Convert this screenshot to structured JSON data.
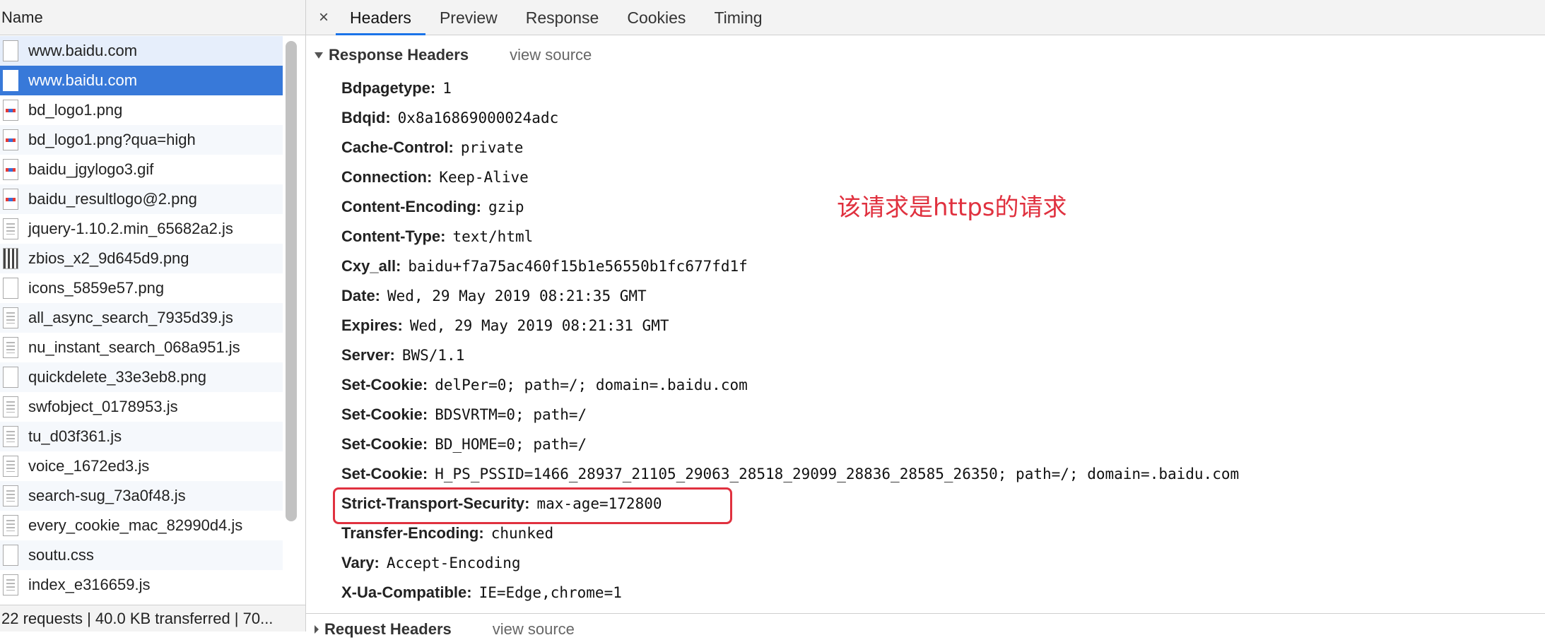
{
  "network_panel": {
    "name_header": "Name",
    "requests": [
      {
        "name": "www.baidu.com",
        "icon": "document-icon",
        "state": "first"
      },
      {
        "name": "www.baidu.com",
        "icon": "document-icon",
        "state": "selected"
      },
      {
        "name": "bd_logo1.png",
        "icon": "image-icon"
      },
      {
        "name": "bd_logo1.png?qua=high",
        "icon": "image-icon"
      },
      {
        "name": "baidu_jgylogo3.gif",
        "icon": "image-icon"
      },
      {
        "name": "baidu_resultlogo@2.png",
        "icon": "image-icon"
      },
      {
        "name": "jquery-1.10.2.min_65682a2.js",
        "icon": "script-icon"
      },
      {
        "name": "zbios_x2_9d645d9.png",
        "icon": "qr-image-icon"
      },
      {
        "name": "icons_5859e57.png",
        "icon": "document-icon"
      },
      {
        "name": "all_async_search_7935d39.js",
        "icon": "script-icon"
      },
      {
        "name": "nu_instant_search_068a951.js",
        "icon": "script-icon"
      },
      {
        "name": "quickdelete_33e3eb8.png",
        "icon": "document-icon"
      },
      {
        "name": "swfobject_0178953.js",
        "icon": "script-icon"
      },
      {
        "name": "tu_d03f361.js",
        "icon": "script-icon"
      },
      {
        "name": "voice_1672ed3.js",
        "icon": "script-icon"
      },
      {
        "name": "search-sug_73a0f48.js",
        "icon": "script-icon"
      },
      {
        "name": "every_cookie_mac_82990d4.js",
        "icon": "script-icon"
      },
      {
        "name": "soutu.css",
        "icon": "document-icon"
      },
      {
        "name": "index_e316659.js",
        "icon": "script-icon"
      }
    ],
    "status": "22 requests | 40.0 KB transferred | 70..."
  },
  "detail_panel": {
    "close_glyph": "×",
    "tabs": [
      "Headers",
      "Preview",
      "Response",
      "Cookies",
      "Timing"
    ],
    "active_tab": "Headers",
    "section_title": "Response Headers",
    "view_source": "view source",
    "headers": [
      {
        "key": "Bdpagetype:",
        "value": "1"
      },
      {
        "key": "Bdqid:",
        "value": "0x8a16869000024adc"
      },
      {
        "key": "Cache-Control:",
        "value": "private"
      },
      {
        "key": "Connection:",
        "value": "Keep-Alive"
      },
      {
        "key": "Content-Encoding:",
        "value": "gzip"
      },
      {
        "key": "Content-Type:",
        "value": "text/html"
      },
      {
        "key": "Cxy_all:",
        "value": "baidu+f7a75ac460f15b1e56550b1fc677fd1f"
      },
      {
        "key": "Date:",
        "value": "Wed, 29 May 2019 08:21:35 GMT"
      },
      {
        "key": "Expires:",
        "value": "Wed, 29 May 2019 08:21:31 GMT"
      },
      {
        "key": "Server:",
        "value": "BWS/1.1"
      },
      {
        "key": "Set-Cookie:",
        "value": "delPer=0; path=/; domain=.baidu.com"
      },
      {
        "key": "Set-Cookie:",
        "value": "BDSVRTM=0; path=/"
      },
      {
        "key": "Set-Cookie:",
        "value": "BD_HOME=0; path=/"
      },
      {
        "key": "Set-Cookie:",
        "value": "H_PS_PSSID=1466_28937_21105_29063_28518_29099_28836_28585_26350; path=/; domain=.baidu.com"
      },
      {
        "key": "Strict-Transport-Security:",
        "value": "max-age=172800"
      },
      {
        "key": "Transfer-Encoding:",
        "value": "chunked"
      },
      {
        "key": "Vary:",
        "value": "Accept-Encoding"
      },
      {
        "key": "X-Ua-Compatible:",
        "value": "IE=Edge,chrome=1"
      }
    ],
    "next_section_title": "Request Headers",
    "next_view_source": "view source"
  },
  "annotation": {
    "text": "该请求是https的请求",
    "color": "#e0313f"
  },
  "colors": {
    "selected_row": "#3879d9",
    "active_tab_underline": "#1a73e8"
  }
}
